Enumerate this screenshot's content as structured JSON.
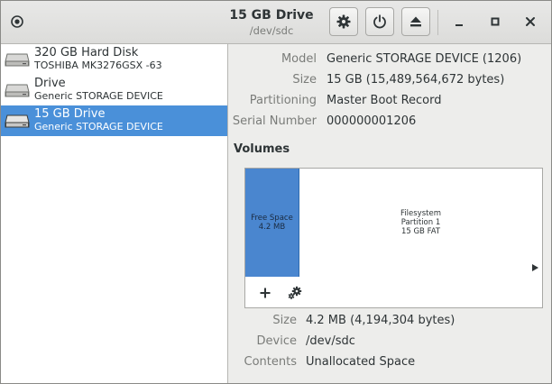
{
  "header": {
    "title": "15 GB Drive",
    "subtitle": "/dev/sdc",
    "buttons": [
      "drive-settings",
      "power-off",
      "eject"
    ],
    "window_controls": [
      "minimize",
      "maximize",
      "close"
    ]
  },
  "sidebar": {
    "items": [
      {
        "name": "320 GB Hard Disk",
        "description": "TOSHIBA MK3276GSX -63",
        "selected": false
      },
      {
        "name": "Drive",
        "description": "Generic STORAGE DEVICE",
        "selected": false
      },
      {
        "name": "15 GB Drive",
        "description": "Generic STORAGE DEVICE",
        "selected": true
      }
    ]
  },
  "drive_properties": {
    "model_label": "Model",
    "model_value": "Generic STORAGE DEVICE (1206)",
    "size_label": "Size",
    "size_value": "15 GB (15,489,564,672 bytes)",
    "partitioning_label": "Partitioning",
    "partitioning_value": "Master Boot Record",
    "serial_label": "Serial Number",
    "serial_value": "000000001206"
  },
  "volumes": {
    "heading": "Volumes",
    "free_space": {
      "line1": "Free Space",
      "line2": "4.2 MB"
    },
    "filesystem": {
      "line1": "Filesystem",
      "line2": "Partition 1",
      "line3": "15 GB FAT"
    }
  },
  "volume_properties": {
    "size_label": "Size",
    "size_value": "4.2 MB (4,194,304 bytes)",
    "device_label": "Device",
    "device_value": "/dev/sdc",
    "contents_label": "Contents",
    "contents_value": "Unallocated Space"
  },
  "colors": {
    "selection": "#4a90d9",
    "free_space": "#4a86cf"
  }
}
